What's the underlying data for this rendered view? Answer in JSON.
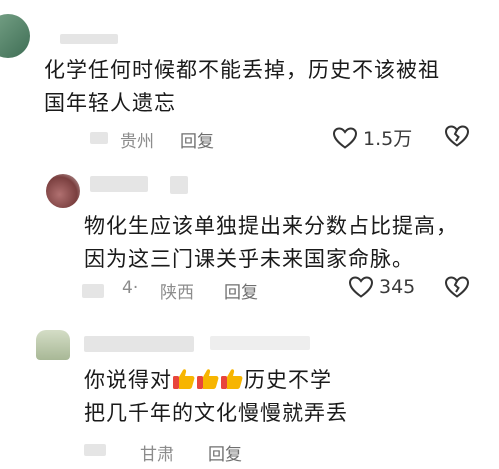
{
  "comments": [
    {
      "text_lines": [
        "化学任何时候都不能丢掉，历史不该被祖",
        "国年轻人遗忘"
      ],
      "location": "贵州",
      "reply_label": "回复",
      "likes": "1.5万"
    },
    {
      "text_lines": [
        "物化生应该单独提出来分数占比提高，",
        "因为这三门课关乎未来国家命脉。"
      ],
      "location_prefix": "4·",
      "location": "陕西",
      "reply_label": "回复",
      "likes": "345"
    },
    {
      "text_pre": "你说得对",
      "emoji": [
        "thumbs-up",
        "thumbs-up",
        "thumbs-up"
      ],
      "text_post": "历史不学",
      "text_line2": "把几千年的文化慢慢就弄丢",
      "location": "甘肃",
      "reply_label": "回复"
    }
  ],
  "colors": {
    "text": "#1a1a1a",
    "meta": "#8c8c8c",
    "emoji": "#f7b500",
    "emoji_sleeve": "#e8453c"
  }
}
